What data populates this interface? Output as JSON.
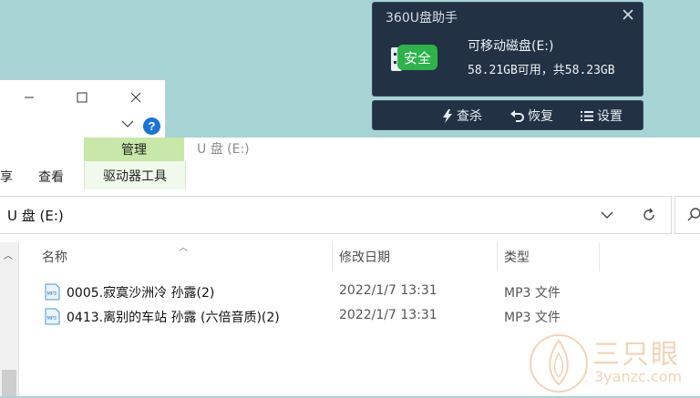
{
  "popup": {
    "title": "360U盘助手",
    "badge": "安全",
    "drive_name": "可移动磁盘(E:)",
    "capacity": "58.21GB可用，共58.23GB",
    "actions": {
      "scan": "查杀",
      "restore": "恢复",
      "settings": "设置"
    },
    "colors": {
      "bg": "#233144",
      "badge": "#2db34a"
    }
  },
  "explorer": {
    "title": "U 盘 (E:)",
    "tabs": {
      "left_partial": "享",
      "view": "查看",
      "context_group": "管理",
      "context_tab": "驱动器工具"
    },
    "address": "U 盘 (E:)",
    "columns": {
      "name": "名称",
      "date": "修改日期",
      "type": "类型"
    },
    "files": [
      {
        "name": "0005.寂寞沙洲冷 孙露(2)",
        "date": "2022/1/7 13:31",
        "type": "MP3 文件"
      },
      {
        "name": "0413.离别的车站 孙露 (六倍音质)(2)",
        "date": "2022/1/7 13:31",
        "type": "MP3 文件"
      }
    ]
  },
  "watermark": {
    "big": "三只眼",
    "small": "3yanzc.com"
  }
}
